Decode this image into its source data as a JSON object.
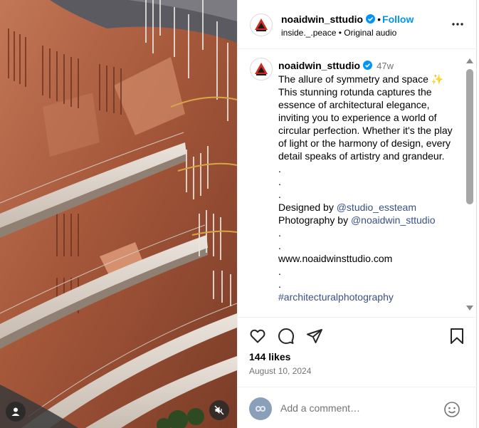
{
  "post": {
    "username": "noaidwin_sttudio",
    "follow_separator": "•",
    "follow_label": "Follow",
    "subline": "inside._.peace • Original audio",
    "time_ago": "47w",
    "caption_lines": [
      "The allure of symmetry and space",
      "This stunning rotunda captures the essence of architectural elegance, inviting you to experience a world of circular perfection. Whether it's the play of light or the harmony of design, every detail speaks of artistry and grandeur.",
      ".",
      ".",
      ".",
      "Designed by",
      "@studio_essteam",
      "Photography by",
      "@noaidwin_sttudio",
      ".",
      ".",
      "www.noaidwinsttudio.com",
      ".",
      ".",
      "#architecturalphotography"
    ],
    "likes": "144 likes",
    "date": "August 10, 2024",
    "comment_placeholder": "Add a comment…"
  },
  "icons": {
    "avatar": "studio-logo-icon",
    "verified": "verified-badge-icon",
    "more": "more-options-icon",
    "like": "heart-icon",
    "comment": "comment-bubble-icon",
    "share": "send-plane-icon",
    "save": "bookmark-icon",
    "emoji": "emoji-smile-icon",
    "user_tag": "user-tag-icon",
    "mute": "muted-speaker-icon"
  },
  "colors": {
    "accent": "#0095f6",
    "link": "#385185",
    "secondary_text": "#737373"
  }
}
